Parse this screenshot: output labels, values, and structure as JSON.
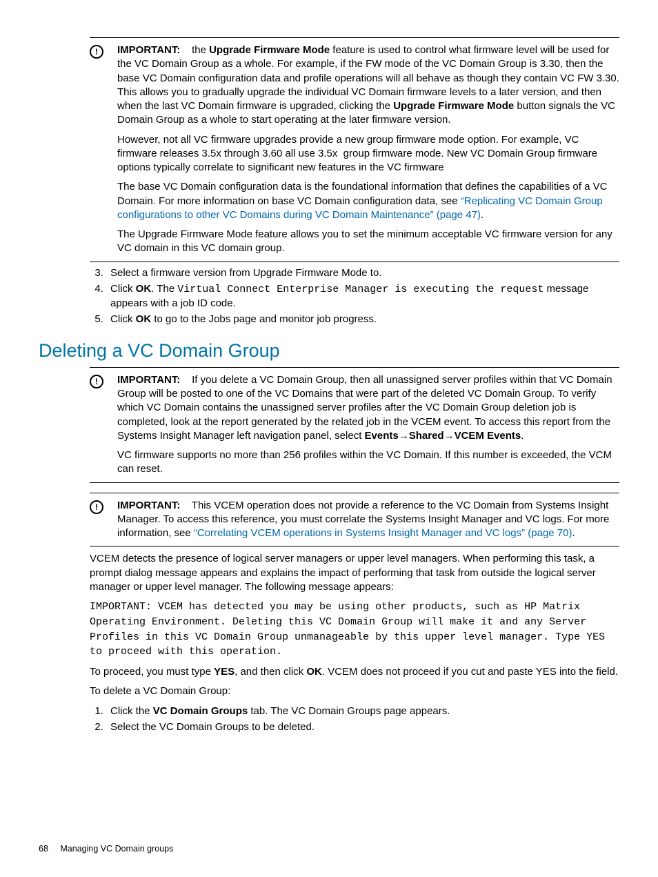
{
  "callout1": {
    "label": "IMPORTANT:",
    "p1a": "the ",
    "p1b": "Upgrade Firmware Mode",
    "p1c": " feature is used to control what firmware level will be used for the VC Domain Group as a whole. For example, if the FW mode of the VC Domain Group is 3.30, then the base VC Domain configuration data and profile operations will all behave as though they contain VC FW 3.30. This allows you to gradually upgrade the individual VC Domain firmware levels to a later version, and then when the last VC Domain firmware is upgraded, clicking the ",
    "p1d": "Upgrade Firmware Mode",
    "p1e": " button signals the VC Domain Group as a whole to start operating at the later firmware version.",
    "p2": "However, not all VC firmware upgrades provide a new group firmware mode option. For example, VC firmware releases 3.5x through 3.60 all use 3.5x  group firmware mode. New VC Domain Group firmware options typically correlate to significant new features in the VC firmware",
    "p3a": "The base VC Domain configuration data is the foundational information that defines the capabilities of a VC Domain. For more information on base VC Domain configuration data, see ",
    "p3link": "“Replicating VC Domain Group configurations to other VC Domains during VC Domain Maintenance” (page 47)",
    "p3b": ".",
    "p4": "The Upgrade Firmware Mode feature allows you to set the minimum acceptable VC firmware version for any VC domain in this VC domain group."
  },
  "steps1": {
    "s3": "Select a firmware version from Upgrade Firmware Mode to.",
    "s4a": "Click ",
    "s4b": "OK",
    "s4c": ". The ",
    "s4d": "Virtual Connect Enterprise Manager is executing the request",
    "s4e": " message appears with a job ID code.",
    "s5a": "Click ",
    "s5b": "OK",
    "s5c": " to go to the Jobs page and monitor job progress."
  },
  "heading": "Deleting a VC Domain Group",
  "callout2": {
    "label": "IMPORTANT:",
    "p1a": "If you delete a VC Domain Group, then all unassigned server profiles within that VC Domain Group will be posted to one of the VC Domains that were part of the deleted VC Domain Group. To verify which VC Domain contains the unassigned server profiles after the VC Domain Group deletion job is completed, look at the report generated by the related job in the VCEM event. To access this report from the Systems Insight Manager left navigation panel, select ",
    "p1b": "Events→Shared→VCEM Events",
    "p1c": ".",
    "p2": "VC firmware supports no more than 256 profiles within the VC Domain. If this number is exceeded, the VCM can reset."
  },
  "callout3": {
    "label": "IMPORTANT:",
    "p1a": "This VCEM operation does not provide a reference to the VC Domain from Systems Insight Manager. To access this reference, you must correlate the Systems Insight Manager and VC logs. For more information, see ",
    "p1link": "“Correlating VCEM operations in Systems Insight Manager and VC logs” (page 70)",
    "p1b": "."
  },
  "body": {
    "p1": "VCEM detects the presence of logical server managers or upper level managers. When performing this task, a prompt dialog message appears and explains the impact of performing that task from outside the logical server manager or upper level manager. The following message appears:",
    "code": "IMPORTANT: VCEM has detected you may be using other products, such as HP Matrix Operating Environment. Deleting this VC Domain Group will make it and any Server Profiles in this VC Domain Group unmanageable by this upper level manager. Type YES to proceed with this operation.",
    "p2a": "To proceed, you must type ",
    "p2b": "YES",
    "p2c": ", and then click ",
    "p2d": "OK",
    "p2e": ". VCEM does not proceed if you cut and paste YES into the field.",
    "p3": "To delete a VC Domain Group:"
  },
  "steps2": {
    "s1a": "Click the ",
    "s1b": "VC Domain Groups",
    "s1c": " tab. The VC Domain Groups page appears.",
    "s2": "Select the VC Domain Groups to be deleted."
  },
  "footer": {
    "page": "68",
    "title": "Managing VC Domain groups"
  }
}
